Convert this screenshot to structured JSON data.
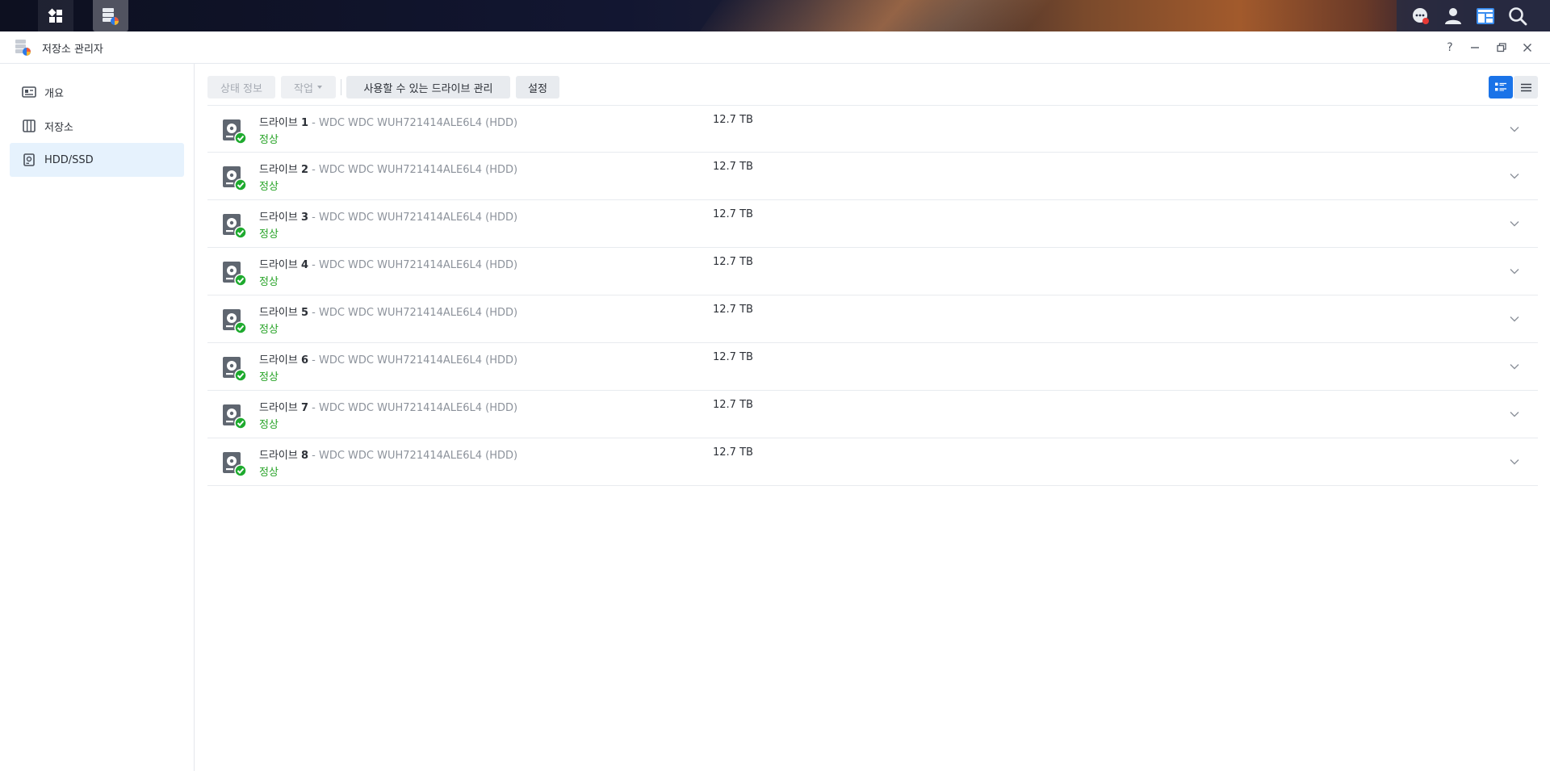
{
  "window": {
    "title": "저장소 관리자",
    "controls": [
      "help-icon",
      "minimize-icon",
      "restore-icon",
      "close-icon"
    ]
  },
  "sidebar": {
    "items": [
      {
        "label": "개요",
        "icon": "overview-icon",
        "active": false
      },
      {
        "label": "저장소",
        "icon": "storage-pool-icon",
        "active": false
      },
      {
        "label": "HDD/SSD",
        "icon": "drive-icon",
        "active": true
      }
    ]
  },
  "toolbar": {
    "status_label": "상태 정보",
    "action_label": "작업",
    "manage_label": "사용할 수 있는 드라이브 관리",
    "settings_label": "설정"
  },
  "drives": [
    {
      "name": "드라이브",
      "number": "1",
      "model": " - WDC WDC WUH721414ALE6L4 (HDD)",
      "status": "정상",
      "size": "12.7 TB"
    },
    {
      "name": "드라이브",
      "number": "2",
      "model": " - WDC WDC WUH721414ALE6L4 (HDD)",
      "status": "정상",
      "size": "12.7 TB"
    },
    {
      "name": "드라이브",
      "number": "3",
      "model": " - WDC WDC WUH721414ALE6L4 (HDD)",
      "status": "정상",
      "size": "12.7 TB"
    },
    {
      "name": "드라이브",
      "number": "4",
      "model": " - WDC WDC WUH721414ALE6L4 (HDD)",
      "status": "정상",
      "size": "12.7 TB"
    },
    {
      "name": "드라이브",
      "number": "5",
      "model": " - WDC WDC WUH721414ALE6L4 (HDD)",
      "status": "정상",
      "size": "12.7 TB"
    },
    {
      "name": "드라이브",
      "number": "6",
      "model": " - WDC WDC WUH721414ALE6L4 (HDD)",
      "status": "정상",
      "size": "12.7 TB"
    },
    {
      "name": "드라이브",
      "number": "7",
      "model": " - WDC WDC WUH721414ALE6L4 (HDD)",
      "status": "정상",
      "size": "12.7 TB"
    },
    {
      "name": "드라이브",
      "number": "8",
      "model": " - WDC WDC WUH721414ALE6L4 (HDD)",
      "status": "정상",
      "size": "12.7 TB"
    }
  ],
  "colors": {
    "accent": "#1a73e8",
    "status_ok": "#27a327",
    "active_nav_bg": "#e6f2fd"
  }
}
